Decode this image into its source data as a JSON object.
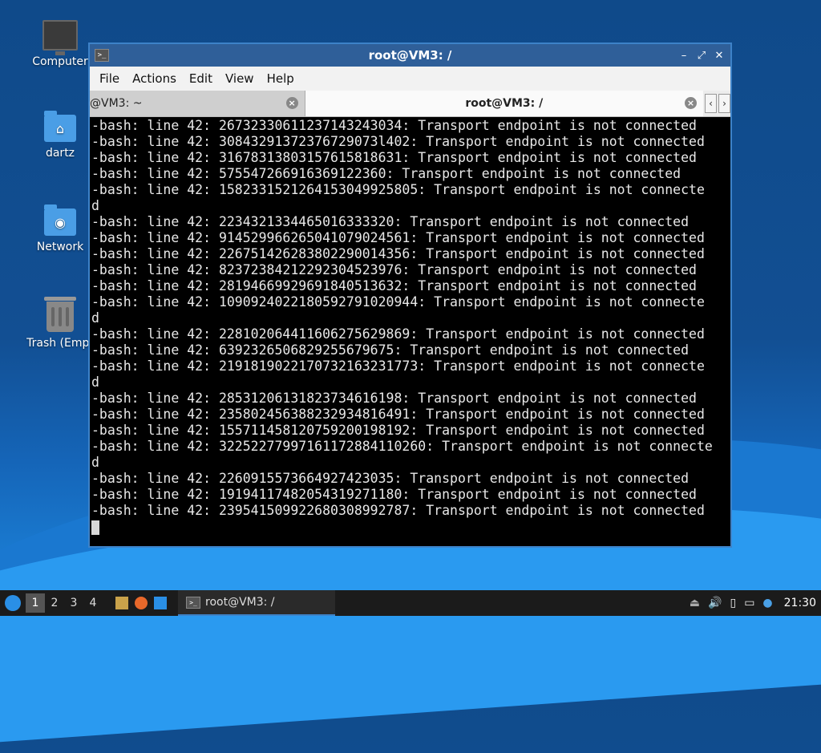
{
  "desktop": {
    "icons": [
      {
        "label": "Computer",
        "icon": "computer-icon"
      },
      {
        "label": "dartz",
        "icon": "home-folder-icon"
      },
      {
        "label": "Network",
        "icon": "network-folder-icon"
      },
      {
        "label": "Trash (Empt",
        "icon": "trash-icon"
      }
    ]
  },
  "window": {
    "title": "root@VM3: /",
    "menu": [
      "File",
      "Actions",
      "Edit",
      "View",
      "Help"
    ],
    "tabs": [
      {
        "label": "@VM3: ~",
        "active": false
      },
      {
        "label": "root@VM3: /",
        "active": true
      }
    ],
    "terminal_lines": [
      "-bash: line 42: 26732330611237143243034: Transport endpoint is not connected",
      "-bash: line 42: 30843291372376729073l402: Transport endpoint is not connected",
      "-bash: line 42: 31678313803157615818631: Transport endpoint is not connected",
      "-bash: line 42: 5755472669163691223​60: Transport endpoint is not connected",
      "-bash: line 42: 158233152126415304992580​5: Transport endpoint is not connecte",
      "d",
      "-bash: line 42: 22343213344650163333​20: Transport endpoint is not connected",
      "-bash: line 42: 91452996626504107902456​1: Transport endpoint is not connected",
      "-bash: line 42: 22675142628380229001435​6: Transport endpoint is not connected",
      "-bash: line 42: 82372384212292304523976: Transport endpoint is not connected",
      "-bash: line 42: 28194669929691840513632: Transport endpoint is not connected",
      "-bash: line 42: 109092402218059279102094​4: Transport endpoint is not connecte",
      "d",
      "-bash: line 42: 22810206441160627562986​9: Transport endpoint is not connected",
      "-bash: line 42: 6392326506829255679675: Transport endpoint is not connected",
      "-bash: line 42: 219181902217073216323177​3: Transport endpoint is not connecte",
      "d",
      "-bash: line 42: 28531206131823734616198: Transport endpoint is not connected",
      "-bash: line 42: 23580245638823293481649​1: Transport endpoint is not connected",
      "-bash: line 42: 15571145812075920019819​2: Transport endpoint is not connected",
      "-bash: line 42: 322522779971611728841102​60: Transport endpoint is not connecte",
      "d",
      "-bash: line 42: 22609155736649274230​35: Transport endpoint is not connected",
      "-bash: line 42: 19194117482054319271180: Transport endpoint is not connected",
      "-bash: line 42: 23954150992268030899278​7: Transport endpoint is not connected"
    ]
  },
  "taskbar": {
    "workspaces": [
      "1",
      "2",
      "3",
      "4"
    ],
    "active_workspace": "1",
    "task_label": "root@VM3: /",
    "clock": "21:30"
  },
  "colors": {
    "title_bar": "#2f5f99",
    "window_border": "#3d82c8",
    "terminal_bg": "#000000",
    "terminal_fg": "#e8e8e8"
  }
}
